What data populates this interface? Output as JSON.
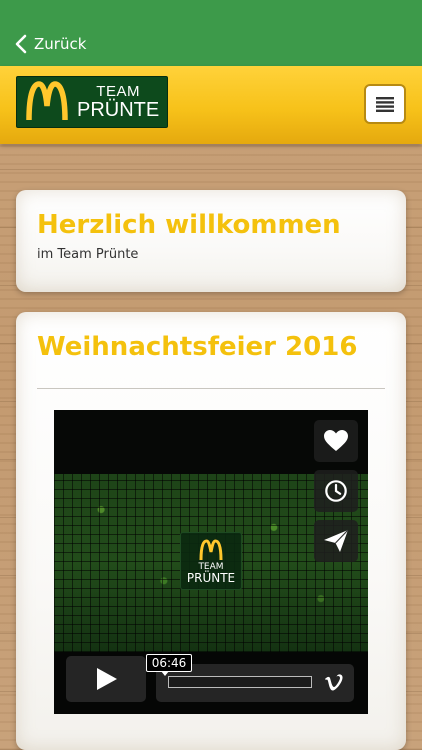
{
  "nav": {
    "back_label": "Zurück"
  },
  "header": {
    "logo_line1": "TEAM",
    "logo_line2": "PRÜNTE"
  },
  "welcome_card": {
    "title": "Herzlich willkommen",
    "subtitle": "im Team Prünte"
  },
  "post_card": {
    "title": "Weihnachtsfeier 2016",
    "video": {
      "logo_line1": "TEAM",
      "logo_line2": "PRÜNTE",
      "current_time": "06:46",
      "progress": 0.0,
      "side_buttons": [
        "heart-icon",
        "clock-icon",
        "send-icon"
      ],
      "provider_icon": "vimeo-icon"
    }
  },
  "colors": {
    "status_bar": "#3d9a4a",
    "header_yellow": "#f7c21a",
    "title_yellow": "#f4c10d",
    "logo_green": "#0d4a1c"
  }
}
